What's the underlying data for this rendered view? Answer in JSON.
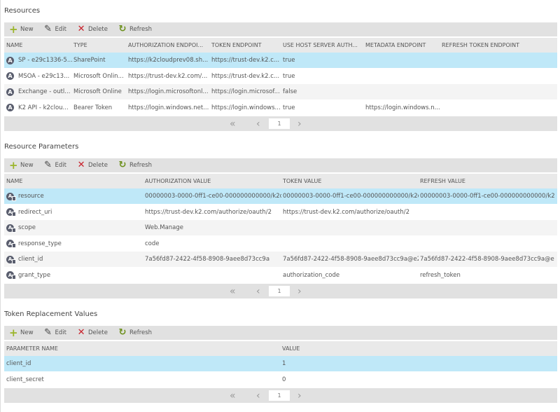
{
  "toolbar": {
    "new": "New",
    "edit": "Edit",
    "delete": "Delete",
    "refresh": "Refresh"
  },
  "pager": {
    "page": "1"
  },
  "sections": [
    {
      "title": "Resources",
      "row_icon": "resource-icon",
      "columns": [
        "NAME",
        "TYPE",
        "AUTHORIZATION ENDPOI...",
        "TOKEN ENDPOINT",
        "USE HOST SERVER AUTH...",
        "METADATA ENDPOINT",
        "REFRESH TOKEN ENDPOINT"
      ],
      "selected_row": 0,
      "rows": [
        [
          "SP - e29c1336-5...",
          "SharePoint",
          "https://k2cloudprev08.sh...",
          "https://trust-dev.k2.c...",
          "true",
          "",
          ""
        ],
        [
          "MSOA - e29c13...",
          "Microsoft Onlin...",
          "https://trust-dev.k2.com/...",
          "https://trust-dev.k2.c...",
          "true",
          "",
          ""
        ],
        [
          "Exchange - outl...",
          "Microsoft Online",
          "https://login.microsoftonl...",
          "https://login.microsof...",
          "false",
          "",
          ""
        ],
        [
          "K2 API - k2clou...",
          "Bearer Token",
          "https://login.windows.net...",
          "https://login.windows...",
          "true",
          "https://login.windows.n...",
          ""
        ]
      ]
    },
    {
      "title": "Resource Parameters",
      "row_icon": "parameter-icon",
      "columns": [
        "NAME",
        "AUTHORIZATION VALUE",
        "TOKEN VALUE",
        "REFRESH VALUE"
      ],
      "selected_row": 0,
      "rows": [
        [
          "resource",
          "00000003-0000-0ff1-ce00-000000000000/k2cl...",
          "00000003-0000-0ff1-ce00-000000000000/k2cl...",
          "00000003-0000-0ff1-ce00-000000000000/k2cl..."
        ],
        [
          "redirect_uri",
          "https://trust-dev.k2.com/authorize/oauth/2",
          "https://trust-dev.k2.com/authorize/oauth/2",
          ""
        ],
        [
          "scope",
          "Web.Manage",
          "",
          ""
        ],
        [
          "response_type",
          "code",
          "",
          ""
        ],
        [
          "client_id",
          "7a56fd87-2422-4f58-8908-9aee8d73cc9a",
          "7a56fd87-2422-4f58-8908-9aee8d73cc9a@e2...",
          "7a56fd87-2422-4f58-8908-9aee8d73cc9a@e2..."
        ],
        [
          "grant_type",
          "",
          "authorization_code",
          "refresh_token"
        ]
      ]
    },
    {
      "title": "Token Replacement Values",
      "row_icon": "",
      "columns": [
        "PARAMETER NAME",
        "VALUE"
      ],
      "selected_row": 0,
      "rows": [
        [
          "client_id",
          "1"
        ],
        [
          "client_secret",
          "0"
        ]
      ]
    }
  ]
}
